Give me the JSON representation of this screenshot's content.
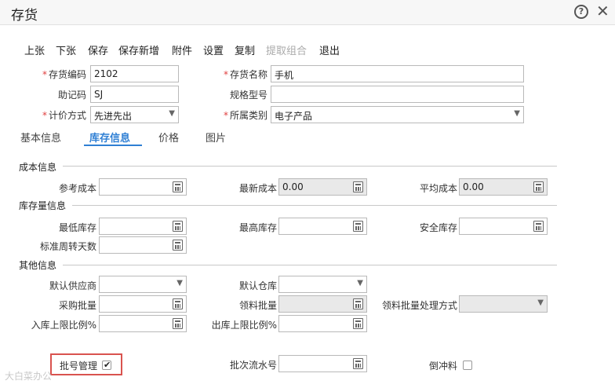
{
  "window": {
    "title": "存货"
  },
  "toolbar": [
    "上张",
    "下张",
    "保存",
    "保存新增",
    "附件",
    "设置",
    "复制",
    "提取组合",
    "退出"
  ],
  "fields": {
    "code_label": "存货编码",
    "code_value": "2102",
    "name_label": "存货名称",
    "name_value": "手机",
    "mnemonic_label": "助记码",
    "mnemonic_value": "SJ",
    "spec_label": "规格型号",
    "spec_value": "",
    "pricing_label": "计价方式",
    "pricing_value": "先进先出",
    "category_label": "所属类别",
    "category_value": "电子产品"
  },
  "tabs": [
    "基本信息",
    "库存信息",
    "价格",
    "图片"
  ],
  "cost": {
    "title": "成本信息",
    "ref_label": "参考成本",
    "ref_value": "",
    "latest_label": "最新成本",
    "latest_value": "0.00",
    "avg_label": "平均成本",
    "avg_value": "0.00"
  },
  "stock": {
    "title": "库存量信息",
    "min_label": "最低库存",
    "max_label": "最高库存",
    "safe_label": "安全库存",
    "turnover_label": "标准周转天数"
  },
  "other": {
    "title": "其他信息",
    "supplier_label": "默认供应商",
    "warehouse_label": "默认仓库",
    "purchase_label": "采购批量",
    "pick_label": "领料批量",
    "pick_method_label": "领料批量处理方式",
    "in_limit_label": "入库上限比例%",
    "out_limit_label": "出库上限比例%",
    "batch_mgmt_label": "批号管理",
    "batch_serial_label": "批次流水号",
    "backflush_label": "倒冲料"
  },
  "watermark": "大白菜办公"
}
